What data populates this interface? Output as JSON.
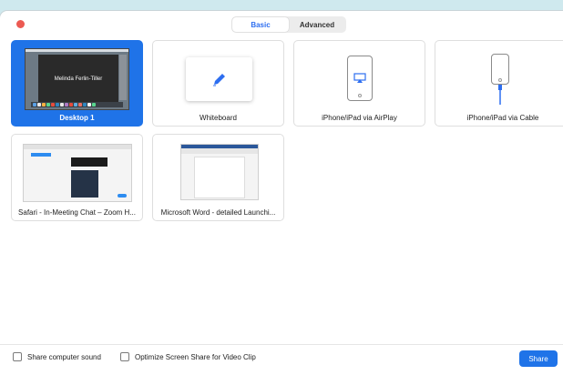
{
  "tabs": [
    {
      "label": "Basic",
      "active": true
    },
    {
      "label": "Advanced",
      "active": false
    }
  ],
  "sources": [
    {
      "label": "Desktop 1",
      "selected": true
    },
    {
      "label": "Whiteboard",
      "selected": false
    },
    {
      "label": "iPhone/iPad via AirPlay",
      "selected": false
    },
    {
      "label": "iPhone/iPad via Cable",
      "selected": false
    },
    {
      "label": "Safari - In-Meeting Chat – Zoom H...",
      "selected": false
    },
    {
      "label": "Microsoft Word - detailed Launchi...",
      "selected": false
    }
  ],
  "desktop_preview": {
    "name": "Melinda Ferlin-Tiller"
  },
  "options": {
    "share_sound": "Share computer sound",
    "optimize_video": "Optimize Screen Share for Video Clip"
  },
  "share_label": "Share",
  "colors": {
    "accent": "#1f73e8",
    "close": "#ec5a52",
    "background": "#cfe9ee"
  }
}
